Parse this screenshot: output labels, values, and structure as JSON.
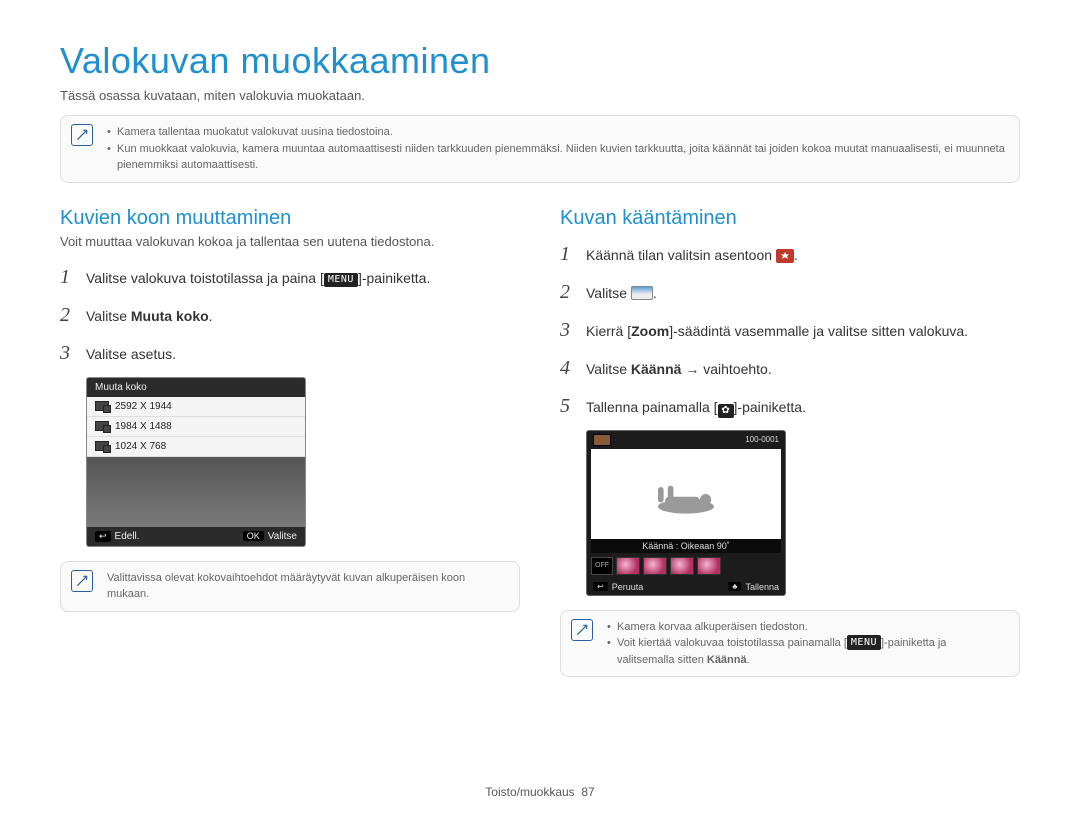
{
  "page": {
    "title": "Valokuvan muokkaaminen",
    "lead": "Tässä osassa kuvataan, miten valokuvia muokataan."
  },
  "top_note": {
    "items": [
      "Kamera tallentaa muokatut valokuvat uusina tiedostoina.",
      "Kun muokkaat valokuvia, kamera muuntaa automaattisesti niiden tarkkuuden pienemmäksi. Niiden kuvien tarkkuutta, joita käännät tai joiden kokoa muutat manuaalisesti, ei muunneta pienemmiksi automaattisesti."
    ]
  },
  "left": {
    "heading": "Kuvien koon muuttaminen",
    "lead": "Voit muuttaa valokuvan kokoa ja tallentaa sen uutena tiedostona.",
    "steps": {
      "s1_a": "Valitse valokuva toistotilassa ja paina [",
      "s1_chip": "MENU",
      "s1_b": "]-painiketta.",
      "s2_a": "Valitse ",
      "s2_b": "Muuta koko",
      "s2_c": ".",
      "s3": "Valitse asetus."
    },
    "ui": {
      "header": "Muuta koko",
      "options": [
        "2592 X 1944",
        "1984 X 1488",
        "1024 X 768"
      ],
      "back_key": "↩",
      "back_label": "Edell.",
      "ok_key": "OK",
      "ok_label": "Valitse"
    },
    "note": "Valittavissa olevat kokovaihtoehdot määräytyvät kuvan alkuperäisen koon mukaan."
  },
  "right": {
    "heading": "Kuvan kääntäminen",
    "steps": {
      "s1_a": "Käännä tilan valitsin asentoon ",
      "s1_b": ".",
      "s2_a": "Valitse ",
      "s2_b": ".",
      "s3_a": "Kierrä [",
      "s3_zoom": "Zoom",
      "s3_b": "]-säädintä vasemmalle ja valitse sitten valokuva.",
      "s4_a": "Valitse ",
      "s4_b": "Käännä",
      "s4_c": " → vaihtoehto.",
      "s5_a": "Tallenna painamalla [",
      "s5_b": "]-painiketta."
    },
    "ui": {
      "file_no": "100-0001",
      "caption": "Käännä : Oikeaan 90˚",
      "off": "OFF",
      "back_key": "↩",
      "back_label": "Peruuta",
      "ok_key": "♣",
      "ok_label": "Tallenna"
    },
    "note": {
      "items": [
        "Kamera korvaa alkuperäisen tiedoston.",
        "Voit kiertää valokuvaa toistotilassa painamalla [MENU]-painiketta ja valitsemalla sitten Käännä."
      ],
      "b1": "Kamera korvaa alkuperäisen tiedoston.",
      "b2_a": "Voit kiertää valokuvaa toistotilassa painamalla [",
      "b2_chip": "MENU",
      "b2_b": "]-painiketta ja valitsemalla sitten ",
      "b2_c": "Käännä",
      "b2_d": "."
    }
  },
  "footer": {
    "section": "Toisto/muokkaus",
    "page": "87"
  }
}
